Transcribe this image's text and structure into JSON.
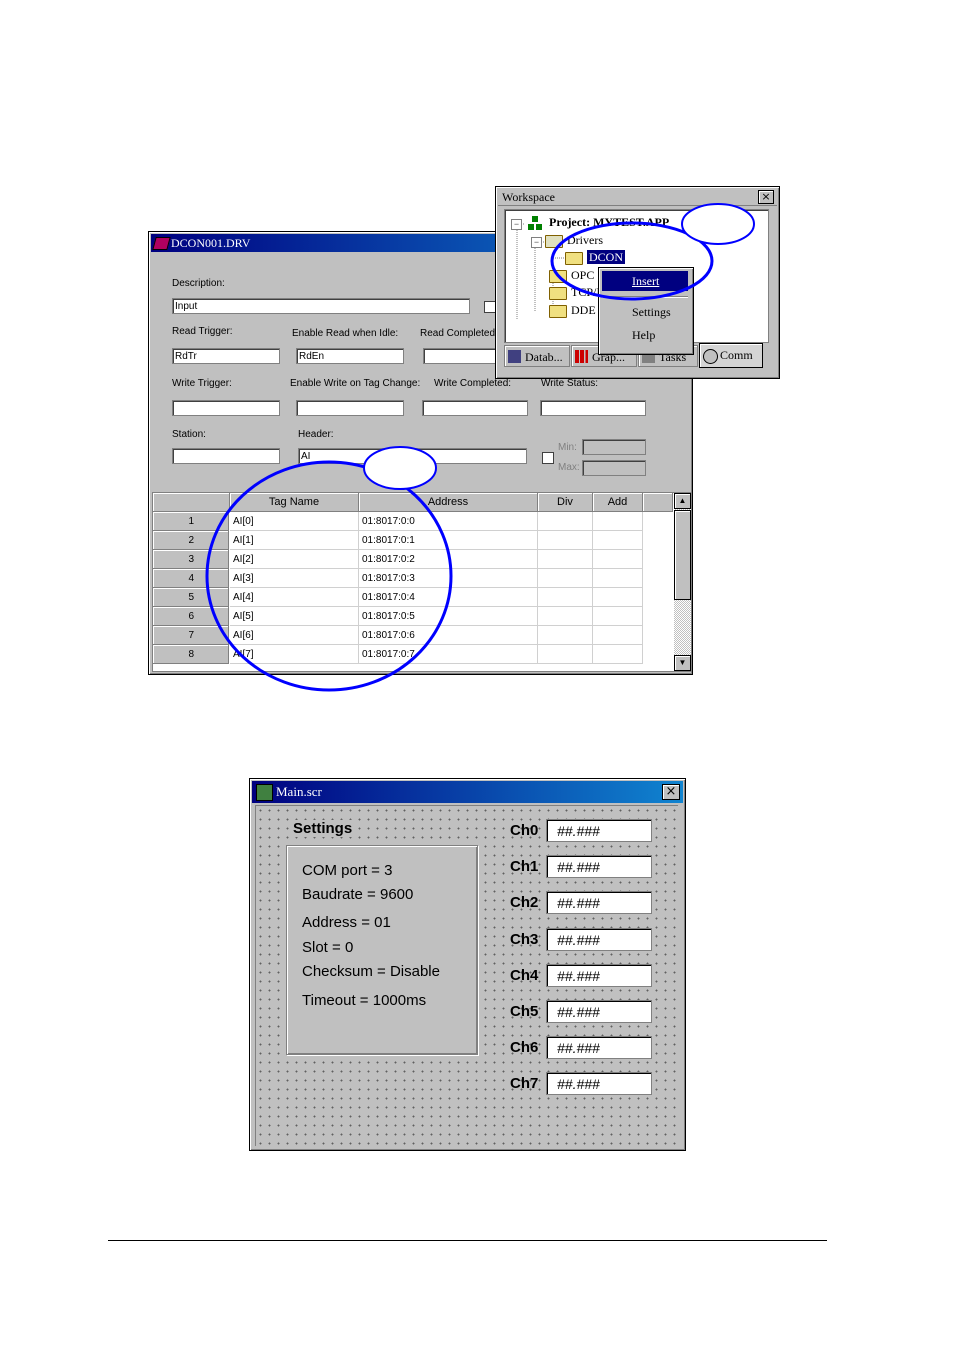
{
  "drv_window": {
    "title": "DCON001.DRV",
    "description_label": "Description:",
    "description_value": "Input",
    "read_trigger_label": "Read Trigger:",
    "read_trigger_value": "RdTr",
    "enable_read_label": "Enable Read when Idle:",
    "enable_read_value": "RdEn",
    "read_completed_label": "Read Completed",
    "write_trigger_label": "Write Trigger:",
    "enable_write_label": "Enable Write on Tag Change:",
    "write_completed_label": "Write Completed:",
    "write_status_label": "Write Status:",
    "station_label": "Station:",
    "header_label": "Header:",
    "header_value": "AI",
    "min_label": "Min:",
    "max_label": "Max:",
    "grid": {
      "columns": [
        "Tag Name",
        "Address",
        "Div",
        "Add"
      ],
      "rows": [
        {
          "num": "1",
          "tag": "AI[0]",
          "address": "01:8017:0:0"
        },
        {
          "num": "2",
          "tag": "AI[1]",
          "address": "01:8017:0:1"
        },
        {
          "num": "3",
          "tag": "AI[2]",
          "address": "01:8017:0:2"
        },
        {
          "num": "4",
          "tag": "AI[3]",
          "address": "01:8017:0:3"
        },
        {
          "num": "5",
          "tag": "AI[4]",
          "address": "01:8017:0:4"
        },
        {
          "num": "6",
          "tag": "AI[5]",
          "address": "01:8017:0:5"
        },
        {
          "num": "7",
          "tag": "AI[6]",
          "address": "01:8017:0:6"
        },
        {
          "num": "8",
          "tag": "AI[7]",
          "address": "01:8017:0:7"
        }
      ]
    }
  },
  "workspace": {
    "title": "Workspace",
    "tree": {
      "project": "Project: MYTEST.APP",
      "drivers": "Drivers",
      "dcon": "DCON",
      "opc": "OPC",
      "tcp": "TCP/IP",
      "dde": "DDE"
    },
    "context_menu": [
      "Insert",
      "Settings",
      "Help"
    ],
    "tabs": [
      "Datab...",
      "Grap...",
      "Tasks",
      "Comm"
    ]
  },
  "main_window": {
    "title": "Main.scr",
    "settings_title": "Settings",
    "settings_lines": [
      "COM port = 3",
      "Baudrate = 9600",
      "Address = 01",
      "Slot = 0",
      "Checksum = Disable",
      "Timeout = 1000ms"
    ],
    "channels": [
      {
        "label": "Ch0",
        "value": "##.###"
      },
      {
        "label": "Ch1",
        "value": "##.###"
      },
      {
        "label": "Ch2",
        "value": "##.###"
      },
      {
        "label": "Ch3",
        "value": "##.###"
      },
      {
        "label": "Ch4",
        "value": "##.###"
      },
      {
        "label": "Ch5",
        "value": "##.###"
      },
      {
        "label": "Ch6",
        "value": "##.###"
      },
      {
        "label": "Ch7",
        "value": "##.###"
      }
    ]
  },
  "colors": {
    "titlebar": "#000080",
    "window_face": "#c0c0c0",
    "annotation_circle": "#0000ff",
    "menu_highlight": "#000080"
  }
}
